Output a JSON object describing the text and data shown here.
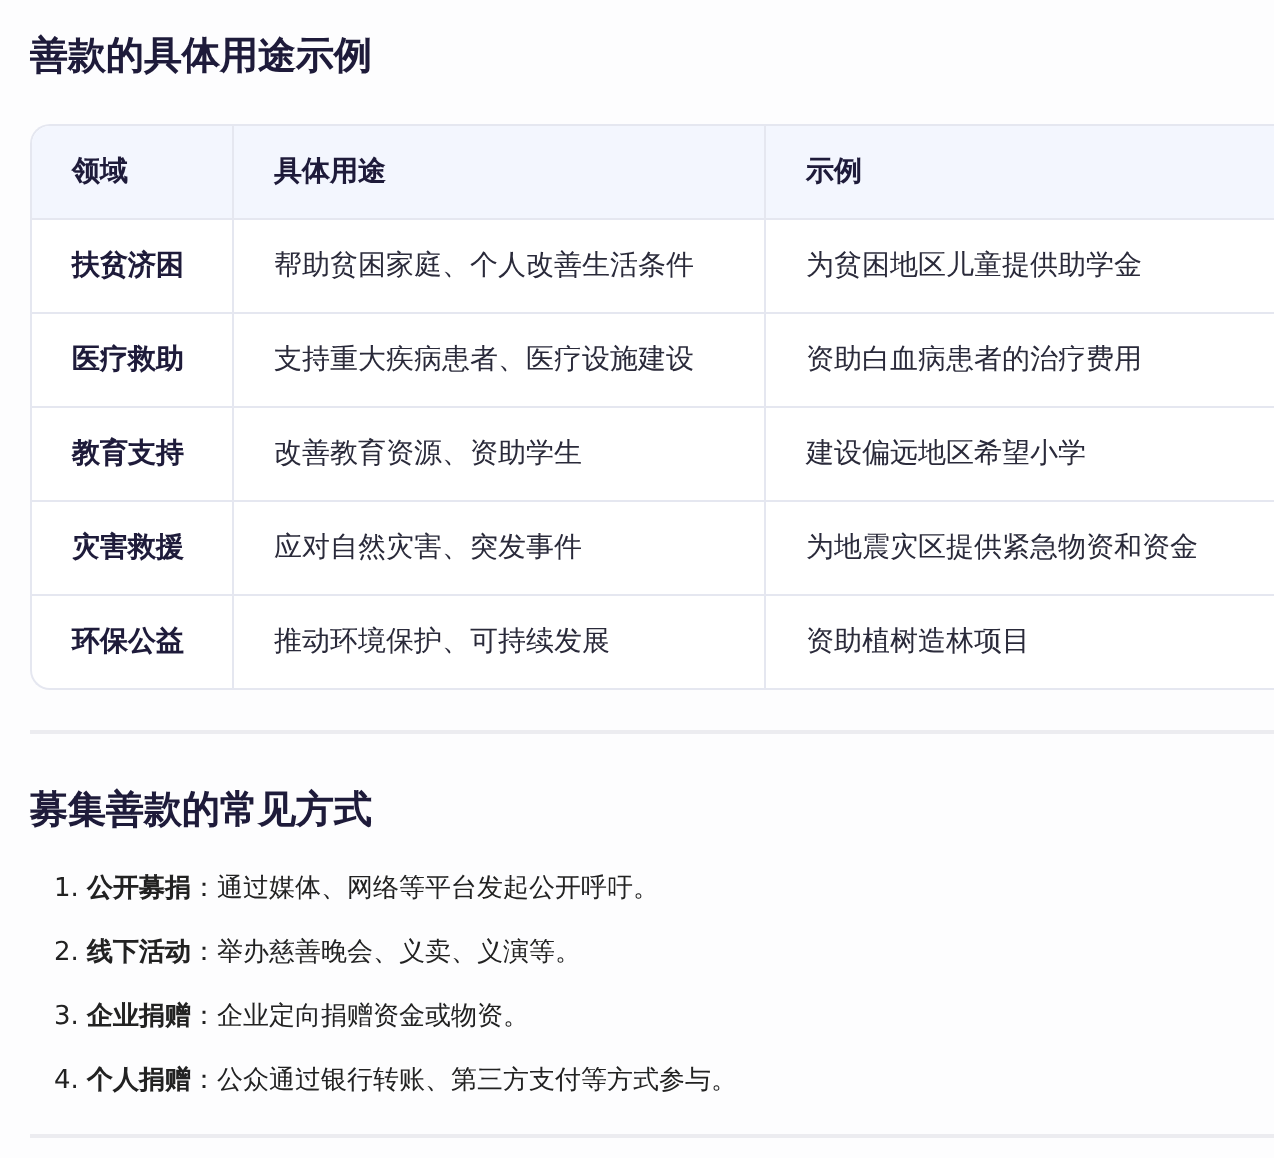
{
  "table_section": {
    "title": "善款的具体用途示例",
    "table": {
      "columns": [
        "领域",
        "具体用途",
        "示例"
      ],
      "rows": [
        [
          "扶贫济困",
          "帮助贫困家庭、个人改善生活条件",
          "为贫困地区儿童提供助学金"
        ],
        [
          "医疗救助",
          "支持重大疾病患者、医疗设施建设",
          "资助白血病患者的治疗费用"
        ],
        [
          "教育支持",
          "改善教育资源、资助学生",
          "建设偏远地区希望小学"
        ],
        [
          "灾害救援",
          "应对自然灾害、突发事件",
          "为地震灾区提供紧急物资和资金"
        ],
        [
          "环保公益",
          "推动环境保护、可持续发展",
          "资助植树造林项目"
        ]
      ]
    }
  },
  "list_section": {
    "title": "募集善款的常见方式",
    "items": [
      {
        "number": "1.",
        "text": "**公开募捐**：通过媒体、网络等平台发起公开呼吁。"
      },
      {
        "number": "2.",
        "text": "**线下活动**：举办慈善晚会、义卖、义演等。"
      },
      {
        "number": "3.",
        "text": "**企业捐赠**：企业定向捐赠资金或物资。"
      },
      {
        "number": "4.",
        "text": "**个人捐赠**：公众通过银行转账、第三方支付等方式参与。"
      }
    ]
  }
}
